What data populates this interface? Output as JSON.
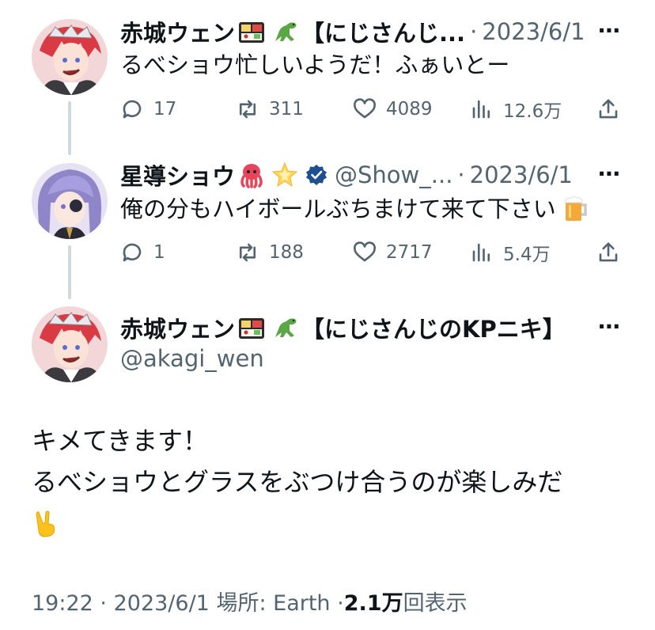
{
  "tweets": [
    {
      "name": "赤城ウェン",
      "name_suffix": "【にじさんじ...",
      "separator": "·",
      "date": "2023/6/1",
      "text": "るべショウ忙しいようだ！ふぁいとー",
      "replies": "17",
      "retweets": "311",
      "likes": "4089",
      "views": "12.6万"
    },
    {
      "name": "星導ショウ",
      "handle": "@Show_...",
      "separator": "·",
      "date": "2023/6/1",
      "text": "俺の分もハイボールぶちまけて来て下さい",
      "replies": "1",
      "retweets": "188",
      "likes": "2717",
      "views": "5.4万"
    }
  ],
  "main": {
    "name": "赤城ウェン",
    "name_suffix": "【にじさんじのKPニキ】",
    "handle": "@akagi_wen",
    "text_line1": "キメてきます！",
    "text_line2": "るべショウとグラスをぶつけ合うのが楽しみだ",
    "time": "19:22",
    "sep1": "·",
    "date": "2023/6/1",
    "location_label": "場所: Earth",
    "sep2": "·",
    "view_count": "2.1万",
    "view_label": "回表示"
  },
  "more_icon": "⋯",
  "colors": {
    "text": "#0f1419",
    "secondary": "#536471",
    "verified": "#1d4f91",
    "line": "#cfd9de"
  }
}
